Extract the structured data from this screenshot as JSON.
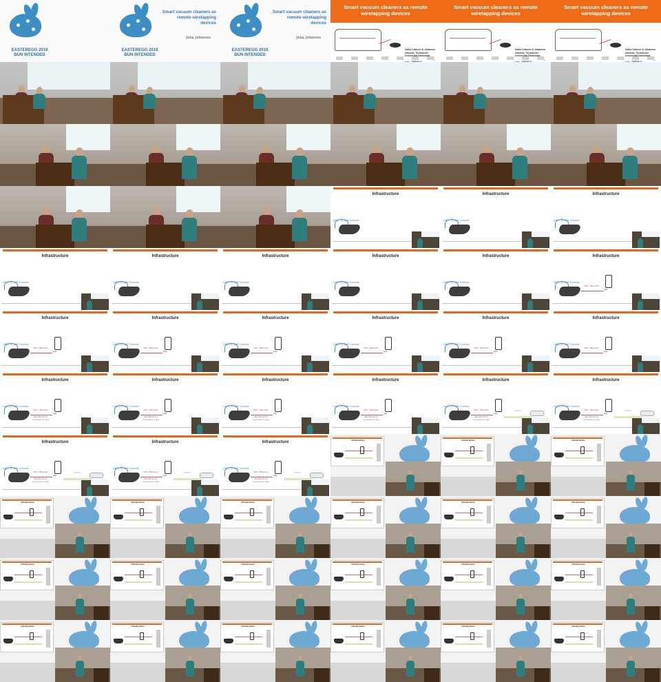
{
  "sheet": {
    "cols": 6,
    "rows": 11,
    "tiles": [
      {
        "kind": "title-logo"
      },
      {
        "kind": "title-text"
      },
      {
        "kind": "title-text"
      },
      {
        "kind": "title-orange"
      },
      {
        "kind": "title-orange"
      },
      {
        "kind": "title-orange"
      },
      {
        "kind": "hall"
      },
      {
        "kind": "hall"
      },
      {
        "kind": "hall"
      },
      {
        "kind": "hall"
      },
      {
        "kind": "hall"
      },
      {
        "kind": "hall"
      },
      {
        "kind": "camera"
      },
      {
        "kind": "camera"
      },
      {
        "kind": "camera"
      },
      {
        "kind": "camera"
      },
      {
        "kind": "camera"
      },
      {
        "kind": "camera"
      },
      {
        "kind": "camera"
      },
      {
        "kind": "camera"
      },
      {
        "kind": "camera"
      },
      {
        "kind": "slide-0"
      },
      {
        "kind": "slide-0"
      },
      {
        "kind": "slide-0"
      },
      {
        "kind": "slide-0"
      },
      {
        "kind": "slide-0"
      },
      {
        "kind": "slide-0"
      },
      {
        "kind": "slide-0"
      },
      {
        "kind": "slide-0"
      },
      {
        "kind": "slide-1"
      },
      {
        "kind": "slide-1"
      },
      {
        "kind": "slide-1"
      },
      {
        "kind": "slide-1"
      },
      {
        "kind": "slide-1"
      },
      {
        "kind": "slide-1"
      },
      {
        "kind": "slide-1"
      },
      {
        "kind": "slide-2"
      },
      {
        "kind": "slide-2"
      },
      {
        "kind": "slide-2"
      },
      {
        "kind": "slide-2"
      },
      {
        "kind": "slide-3"
      },
      {
        "kind": "slide-3"
      },
      {
        "kind": "slide-3"
      },
      {
        "kind": "slide-3"
      },
      {
        "kind": "slide-3"
      },
      {
        "kind": "mixed"
      },
      {
        "kind": "mixed"
      },
      {
        "kind": "mixed"
      },
      {
        "kind": "mixed"
      },
      {
        "kind": "mixed"
      },
      {
        "kind": "mixed"
      },
      {
        "kind": "mixed"
      },
      {
        "kind": "mixed"
      },
      {
        "kind": "mixed"
      },
      {
        "kind": "mixed"
      },
      {
        "kind": "mixed"
      },
      {
        "kind": "mixed"
      },
      {
        "kind": "mixed"
      },
      {
        "kind": "mixed"
      },
      {
        "kind": "mixed"
      },
      {
        "kind": "mixed"
      },
      {
        "kind": "mixed"
      },
      {
        "kind": "mixed"
      },
      {
        "kind": "mixed"
      },
      {
        "kind": "mixed"
      },
      {
        "kind": "mixed"
      }
    ]
  },
  "text": {
    "easteregg": "EASTEREGG 2019",
    "bun": "BUN INTENDED",
    "talk_title": "Smart vacuum cleaners as remote wiretapping devices",
    "talk_title_orange": "Smart vacuum cleaners as remote wiretapping devices",
    "authors": "jiska, johannes",
    "credit": "Dzika Classen & Johannes Ulbricht, Technische Universität Darmstadt, Secure Mobile Networking Lab - SEEMOO",
    "slide_heading": "Infrastructure",
    "uart_label": "UART & USB Console",
    "wifi_label": "WiFi - Bluetooth",
    "wifi_sub": "Wlan/Bluetooth connection to app",
    "phone_label": "App",
    "cloud_label": "Cloud",
    "green_label": "Internet",
    "mini_heading": "Infrastructure"
  },
  "colors": {
    "orange": "#ef6a16",
    "logo_blue": "#3b8fc4",
    "link_red": "#dd5555",
    "link_green": "#8aab57"
  }
}
